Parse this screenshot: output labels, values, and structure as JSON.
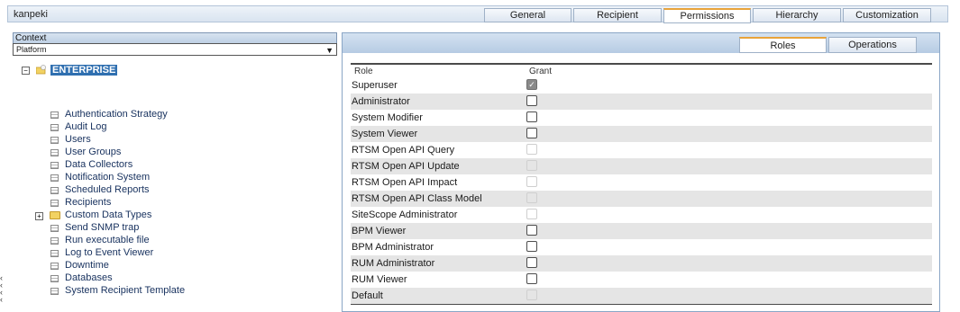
{
  "window": {
    "user": "kanpeki"
  },
  "tabs": [
    {
      "label": "General"
    },
    {
      "label": "Recipient"
    },
    {
      "label": "Permissions"
    },
    {
      "label": "Hierarchy"
    },
    {
      "label": "Customization"
    }
  ],
  "context": {
    "header": "Context",
    "selected": "Platform"
  },
  "tree": {
    "root": "ENTERPRISE",
    "items": [
      "Authentication Strategy",
      "Audit Log",
      "Users",
      "User Groups",
      "Data Collectors",
      "Notification System",
      "Scheduled Reports",
      "Recipients",
      "Custom Data Types",
      "Send SNMP trap",
      "Run executable file",
      "Log to Event Viewer",
      "Downtime",
      "Databases",
      "System Recipient Template"
    ]
  },
  "subtabs": [
    {
      "label": "Roles"
    },
    {
      "label": "Operations"
    }
  ],
  "roles_table": {
    "col_role": "Role",
    "col_grant": "Grant",
    "rows": [
      {
        "role": "Superuser",
        "state": "checked"
      },
      {
        "role": "Administrator",
        "state": "unchecked"
      },
      {
        "role": "System Modifier",
        "state": "unchecked"
      },
      {
        "role": "System Viewer",
        "state": "unchecked"
      },
      {
        "role": "RTSM Open API Query",
        "state": "disabled"
      },
      {
        "role": "RTSM Open API Update",
        "state": "disabled"
      },
      {
        "role": "RTSM Open API Impact",
        "state": "disabled"
      },
      {
        "role": "RTSM Open API Class Model",
        "state": "disabled"
      },
      {
        "role": "SiteScope Administrator",
        "state": "disabled"
      },
      {
        "role": "BPM Viewer",
        "state": "unchecked"
      },
      {
        "role": "BPM Administrator",
        "state": "unchecked"
      },
      {
        "role": "RUM Administrator",
        "state": "unchecked"
      },
      {
        "role": "RUM Viewer",
        "state": "unchecked"
      },
      {
        "role": "Default",
        "state": "disabled"
      }
    ]
  }
}
